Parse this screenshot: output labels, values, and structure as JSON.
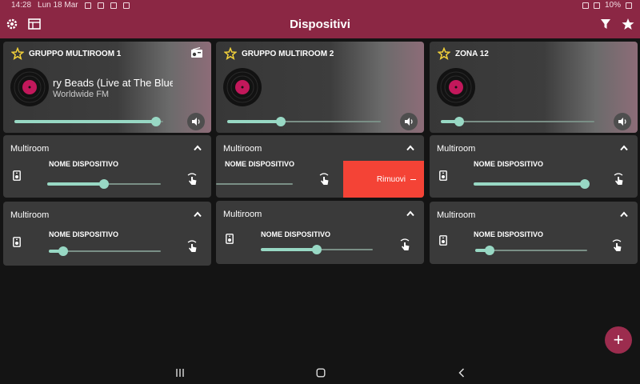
{
  "status": {
    "time": "14:28",
    "date": "Lun 18 Mar",
    "battery": "10%"
  },
  "appbar": {
    "title": "Dispositivi"
  },
  "players": [
    {
      "name": "GRUPPO MULTIROOM 1",
      "track": "ry Beads (Live at The Blue",
      "station": "Worldwide FM",
      "volume": 0.95,
      "favorite": false
    },
    {
      "name": "GRUPPO MULTIROOM 2",
      "track": "",
      "station": "",
      "volume": 0.35,
      "favorite": false
    },
    {
      "name": "ZONA 12",
      "track": "",
      "station": "",
      "volume": 0.12,
      "favorite": false
    }
  ],
  "groups": [
    {
      "label": "Multiroom",
      "device": "NOME DISPOSITIVO",
      "volume": 0.5
    },
    {
      "label": "Multiroom",
      "device": "NOME DISPOSITIVO",
      "volume": 0.6,
      "swipe_action": "Rimuovi"
    },
    {
      "label": "Multiroom",
      "device": "NOME DISPOSITIVO",
      "volume": 0.98
    },
    {
      "label": "Multiroom",
      "device": "NOME DISPOSITIVO",
      "volume": 0.13
    },
    {
      "label": "Multiroom",
      "device": "NOME DISPOSITIVO",
      "volume": 0.5
    },
    {
      "label": "Multiroom",
      "device": "NOME DISPOSITIVO",
      "volume": 0.13
    }
  ],
  "colors": {
    "brand": "#8b2744",
    "accent": "#98d8c4",
    "danger": "#f44336",
    "card": "#3a3a3a"
  },
  "icons": {
    "settings": "gear-icon",
    "layout": "table-icon",
    "filter": "filter-icon",
    "favorites": "star-icon"
  }
}
